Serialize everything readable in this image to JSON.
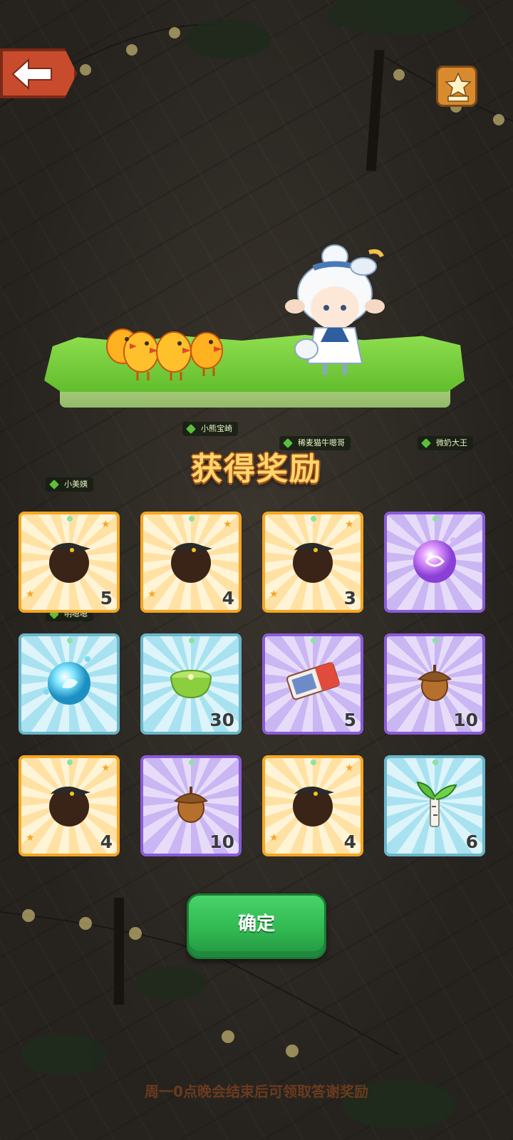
{
  "header": {
    "back_icon": "back-arrow-icon",
    "ranking_icon": "podium-star-icon"
  },
  "name_tags": [
    "小熊宝崎",
    "稀麦猫牛嗯哥",
    "微奶大王",
    "小美姨",
    "明嗯嗯"
  ],
  "title": "获得奖励",
  "rewards": [
    {
      "icon": "black-chick-icon",
      "rarity": "gold",
      "count": "5"
    },
    {
      "icon": "black-chick-icon",
      "rarity": "gold",
      "count": "4"
    },
    {
      "icon": "black-chick-icon",
      "rarity": "gold",
      "count": "3"
    },
    {
      "icon": "purple-orb-icon",
      "rarity": "purple",
      "count": ""
    },
    {
      "icon": "blue-orb-icon",
      "rarity": "blue",
      "count": ""
    },
    {
      "icon": "green-soup-bowl-icon",
      "rarity": "blue",
      "count": "30"
    },
    {
      "icon": "ticket-icon",
      "rarity": "purple",
      "count": "5"
    },
    {
      "icon": "acorn-icon",
      "rarity": "purple",
      "count": "10"
    },
    {
      "icon": "black-chick-icon",
      "rarity": "gold",
      "count": "4"
    },
    {
      "icon": "acorn-icon",
      "rarity": "purple",
      "count": "10"
    },
    {
      "icon": "black-chick-icon",
      "rarity": "gold",
      "count": "4"
    },
    {
      "icon": "birch-sapling-icon",
      "rarity": "blue",
      "count": "6"
    }
  ],
  "confirm_label": "确定",
  "footer_text": "周一0点晚会结束后可领取答谢奖励",
  "colors": {
    "gold_border": "#f5a623",
    "purple_border": "#8a5bd6",
    "blue_border": "#6bb5c9",
    "confirm_green": "#2fb64f",
    "title_yellow": "#ffd66b"
  }
}
